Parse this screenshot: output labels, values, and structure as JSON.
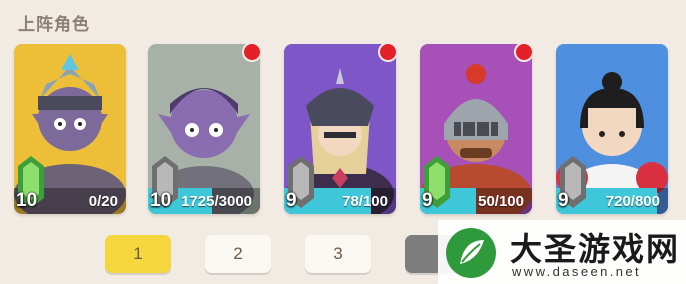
{
  "section": {
    "title": "上阵角色"
  },
  "cards": [
    {
      "level": "10",
      "progress": "0/20",
      "progress_fraction": 0.0,
      "bg": "#f0c43c",
      "badge": "green",
      "red_dot": false,
      "name": "knight-king"
    },
    {
      "level": "10",
      "progress": "1725/3000",
      "progress_fraction": 0.575,
      "bg": "#a7b1a7",
      "badge": "gray",
      "red_dot": true,
      "name": "purple-goblin"
    },
    {
      "level": "9",
      "progress": "78/100",
      "progress_fraction": 0.78,
      "bg": "#7f56c8",
      "badge": "gray",
      "red_dot": true,
      "name": "dark-knight"
    },
    {
      "level": "9",
      "progress": "50/100",
      "progress_fraction": 0.5,
      "bg": "#a650b8",
      "badge": "green",
      "red_dot": true,
      "name": "helmet-warrior"
    },
    {
      "level": "9",
      "progress": "720/800",
      "progress_fraction": 0.9,
      "bg": "#4f8fe0",
      "badge": "gray",
      "red_dot": false,
      "name": "cheerleader"
    }
  ],
  "pages": [
    "1",
    "2",
    "3"
  ],
  "active_page": "1",
  "watermark": {
    "cn": "大圣游戏网",
    "url": "www.daseen.net"
  },
  "colors": {
    "background": "#f1ebe3",
    "active_tab": "#f5d63d",
    "red_dot": "#e4202a",
    "progress": "#3ec7d8"
  }
}
